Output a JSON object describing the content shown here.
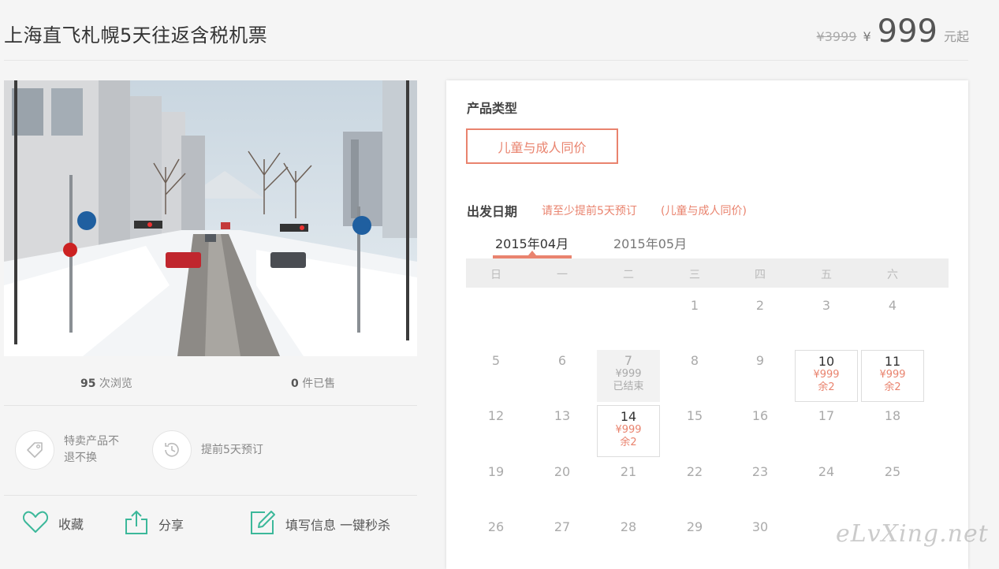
{
  "header": {
    "title": "上海直飞札幌5天往返含税机票",
    "old_price": "¥3999",
    "currency": "¥",
    "price": "999",
    "price_suffix": "元起"
  },
  "stats": {
    "views_count": "95",
    "views_label": " 次浏览",
    "sold_count": "0",
    "sold_label": " 件已售"
  },
  "features": [
    {
      "icon": "tag-icon",
      "text": "特卖产品不退不换"
    },
    {
      "icon": "clock-history-icon",
      "text": "提前5天预订"
    }
  ],
  "actions": {
    "favorite": "收藏",
    "share": "分享",
    "fill_info": "填写信息 一键秒杀"
  },
  "booking": {
    "product_type_label": "产品类型",
    "product_type_option": "儿童与成人同价",
    "departure_label": "出发日期",
    "note_advance": "请至少提前5天预订",
    "note_price": "(儿童与成人同价)",
    "months": [
      "2015年04月",
      "2015年05月"
    ],
    "active_month": "2015年04月",
    "weekdays": [
      "日",
      "一",
      "二",
      "三",
      "四",
      "五",
      "六"
    ],
    "calendar": [
      [
        null,
        null,
        null,
        {
          "d": "1"
        },
        {
          "d": "2"
        },
        {
          "d": "3"
        },
        {
          "d": "4"
        }
      ],
      [
        {
          "d": "5"
        },
        {
          "d": "6"
        },
        {
          "d": "7",
          "price": "¥999",
          "status": "已结束",
          "state": "closed"
        },
        {
          "d": "8"
        },
        {
          "d": "9"
        },
        {
          "d": "10",
          "price": "¥999",
          "status": "余2",
          "state": "open"
        },
        {
          "d": "11",
          "price": "¥999",
          "status": "余2",
          "state": "open"
        }
      ],
      [
        {
          "d": "12"
        },
        {
          "d": "13"
        },
        {
          "d": "14",
          "price": "¥999",
          "status": "余2",
          "state": "open"
        },
        {
          "d": "15"
        },
        {
          "d": "16"
        },
        {
          "d": "17"
        },
        {
          "d": "18"
        }
      ],
      [
        {
          "d": "19"
        },
        {
          "d": "20"
        },
        {
          "d": "21"
        },
        {
          "d": "22"
        },
        {
          "d": "23"
        },
        {
          "d": "24"
        },
        {
          "d": "25"
        }
      ],
      [
        {
          "d": "26"
        },
        {
          "d": "27"
        },
        {
          "d": "28"
        },
        {
          "d": "29"
        },
        {
          "d": "30"
        },
        null,
        null
      ]
    ]
  },
  "watermark": "eLvXing.net",
  "colors": {
    "accent": "#e9836e",
    "icon_green": "#3cb89a"
  }
}
